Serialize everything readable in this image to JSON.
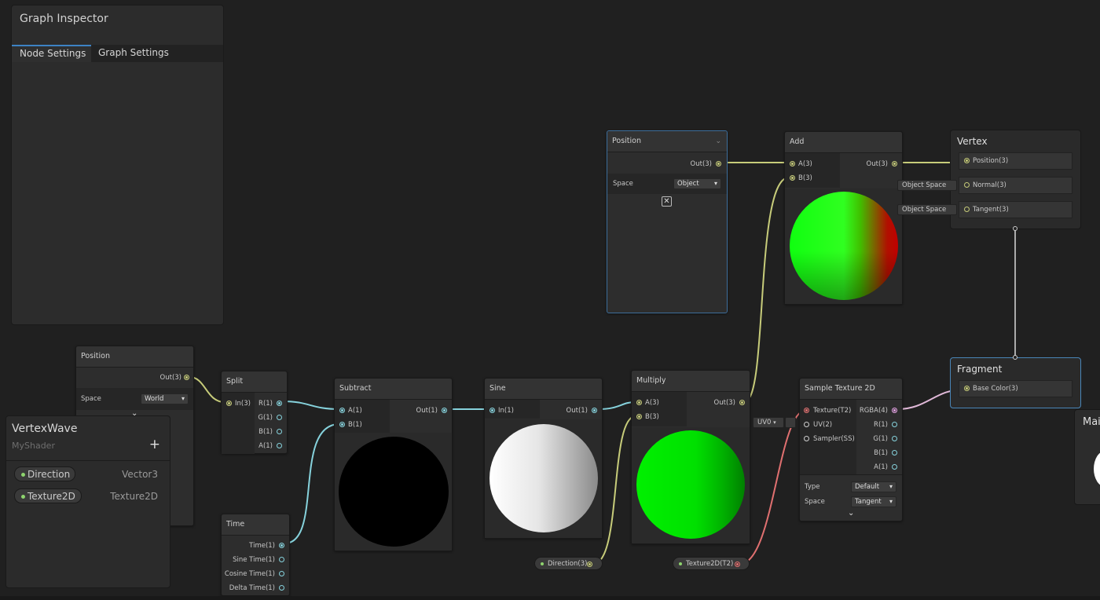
{
  "inspector": {
    "title": "Graph Inspector",
    "tabs": [
      {
        "label": "Node Settings",
        "active": true
      },
      {
        "label": "Graph Settings",
        "active": false
      }
    ]
  },
  "blackboard": {
    "title": "VertexWave",
    "subtitle": "MyShader",
    "add_icon": "plus-icon",
    "properties": [
      {
        "name": "Direction",
        "type": "Vector3"
      },
      {
        "name": "Texture2D",
        "type": "Texture2D"
      }
    ]
  },
  "nodes": {
    "position_world": {
      "title": "Position",
      "output": "Out(3)",
      "space_label": "Space",
      "space_value": "World"
    },
    "position_object": {
      "title": "Position",
      "output": "Out(3)",
      "space_label": "Space",
      "space_value": "Object",
      "preview_icon": "precision-toggle-icon"
    },
    "split": {
      "title": "Split",
      "input": "In(3)",
      "outputs": [
        "R(1)",
        "G(1)",
        "B(1)",
        "A(1)"
      ]
    },
    "time": {
      "title": "Time",
      "outputs": [
        "Time(1)",
        "Sine Time(1)",
        "Cosine Time(1)",
        "Delta Time(1)"
      ]
    },
    "subtract": {
      "title": "Subtract",
      "inputs": [
        "A(1)",
        "B(1)"
      ],
      "output": "Out(1)"
    },
    "sine": {
      "title": "Sine",
      "input": "In(1)",
      "output": "Out(1)"
    },
    "multiply": {
      "title": "Multiply",
      "inputs": [
        "A(3)",
        "B(3)"
      ],
      "output": "Out(3)"
    },
    "add": {
      "title": "Add",
      "inputs": [
        "A(3)",
        "B(3)"
      ],
      "output": "Out(3)"
    },
    "sample_texture": {
      "title": "Sample Texture 2D",
      "inputs": [
        "Texture(T2)",
        "UV(2)",
        "Sampler(SS)"
      ],
      "outputs": [
        "RGBA(4)",
        "R(1)",
        "G(1)",
        "B(1)",
        "A(1)"
      ],
      "uv_value": "UV0",
      "type_label": "Type",
      "type_value": "Default",
      "space_label": "Space",
      "space_value": "Tangent"
    },
    "direction_prop": {
      "label": "Direction(3)"
    },
    "texture_prop": {
      "label": "Texture2D(T2)"
    }
  },
  "master": {
    "vertex": {
      "title": "Vertex",
      "slots": [
        "Position(3)",
        "Normal(3)",
        "Tangent(3)"
      ],
      "defaults": [
        "Object Space",
        "Object Space"
      ]
    },
    "fragment": {
      "title": "Fragment",
      "slots": [
        "Base Color(3)"
      ]
    },
    "main_preview": {
      "title": "Mai"
    }
  },
  "colors": {
    "background": "#202020",
    "vector3_wire": "#c7cc7a",
    "float_wire": "#86d2dc",
    "texture_wire": "#e07070",
    "vector4_wire": "#e0b8d8",
    "selection": "#3d6e9b"
  }
}
